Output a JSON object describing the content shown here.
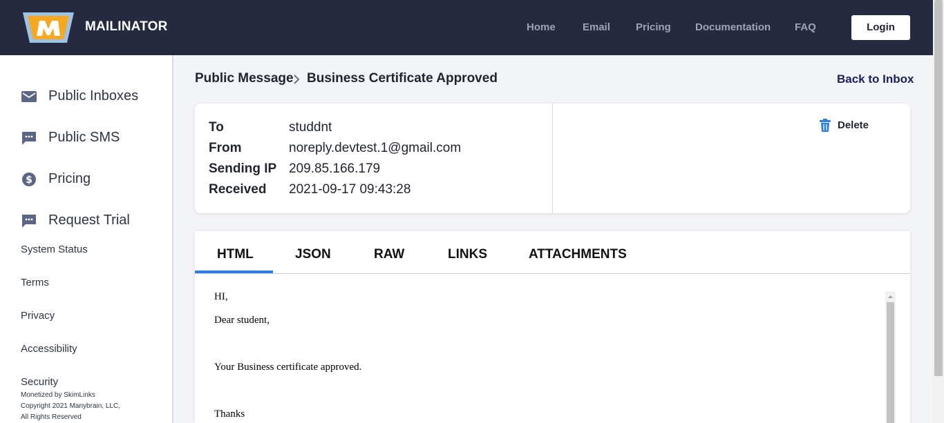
{
  "header": {
    "brand": "MAILINATOR",
    "nav": [
      "Home",
      "Email",
      "Pricing",
      "Documentation",
      "FAQ"
    ],
    "login": "Login"
  },
  "sidebar": {
    "items": [
      {
        "label": "Public Inboxes",
        "icon": "envelope-icon"
      },
      {
        "label": "Public SMS",
        "icon": "chat-bubble-icon"
      },
      {
        "label": "Pricing",
        "icon": "dollar-circle-icon"
      },
      {
        "label": "Request Trial",
        "icon": "chat-bubble-icon"
      }
    ],
    "links": [
      "System Status",
      "Terms",
      "Privacy",
      "Accessibility",
      "Security"
    ],
    "footer": [
      "Monetized by SkimLinks",
      "Copyright 2021 Manybrain, LLC,",
      "All Rights Reserved"
    ]
  },
  "breadcrumb": {
    "root": "Public Message",
    "current": "Business Certificate Approved",
    "back": "Back to Inbox"
  },
  "meta": {
    "to_label": "To",
    "to": "studdnt",
    "from_label": "From",
    "from": "noreply.devtest.1@gmail.com",
    "ip_label": "Sending IP",
    "ip": "209.85.166.179",
    "received_label": "Received",
    "received": "2021-09-17 09:43:28",
    "delete": "Delete"
  },
  "tabs": [
    "HTML",
    "JSON",
    "RAW",
    "LINKS",
    "ATTACHMENTS"
  ],
  "active_tab": "HTML",
  "message": {
    "lines": [
      "HI,",
      "Dear student,",
      "Your Business certificate approved.",
      "Thanks"
    ]
  },
  "colors": {
    "header_bg": "#252a41",
    "accent": "#2a7de1",
    "link": "#1a1f5e",
    "logo_orange": "#f7a823",
    "logo_blue": "#9cc3e6"
  }
}
